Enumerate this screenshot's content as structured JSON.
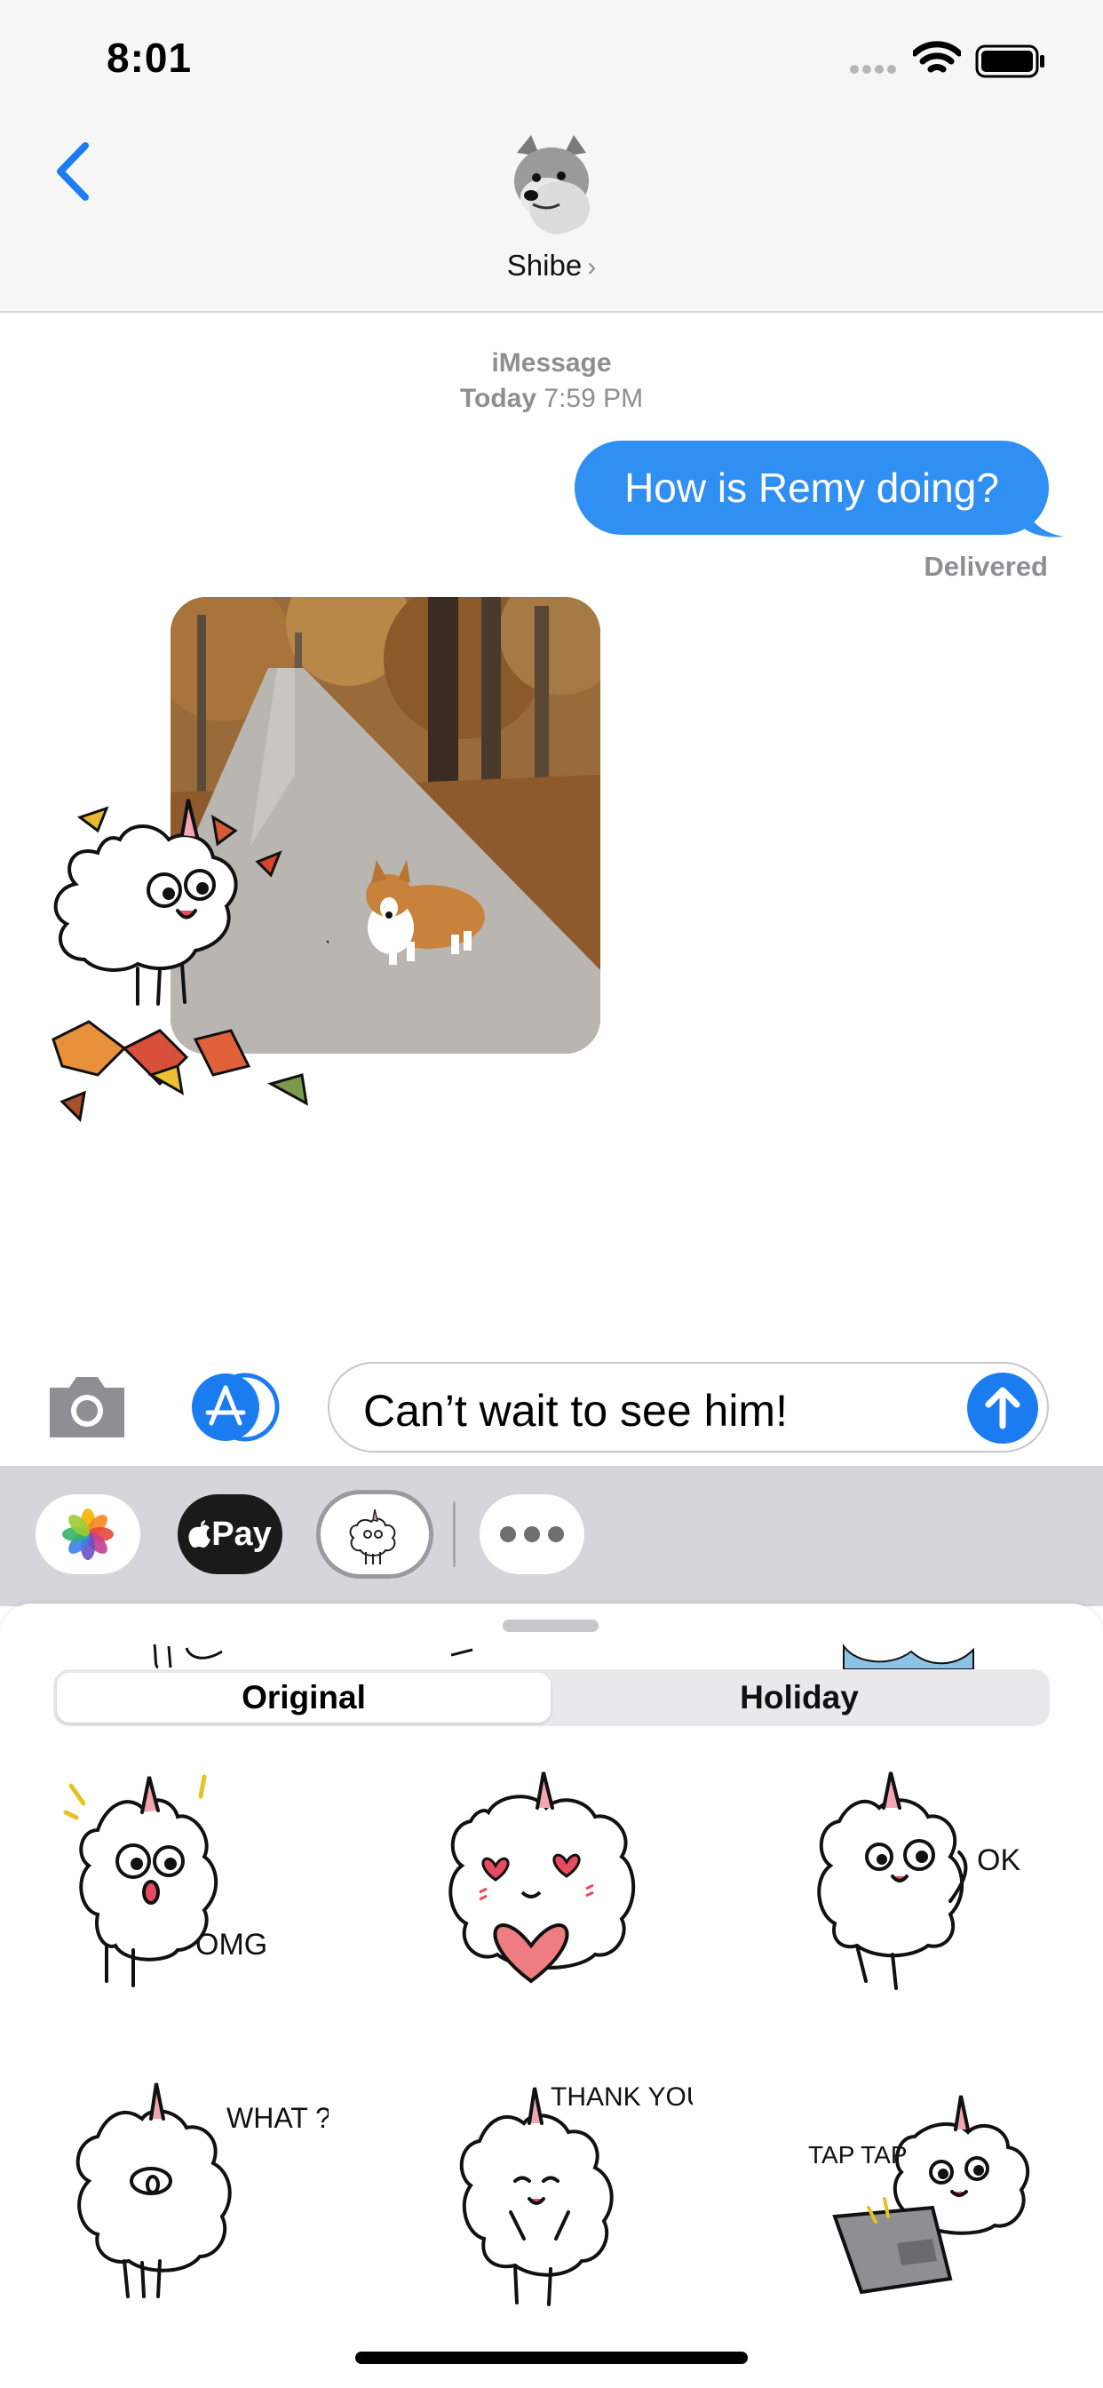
{
  "status_bar": {
    "time": "8:01"
  },
  "header": {
    "contact_name": "Shibe",
    "chevron": "›"
  },
  "conversation": {
    "service": "iMessage",
    "day": "Today",
    "time": "7:59 PM",
    "outgoing_message": "How is Remy doing?",
    "delivery_status": "Delivered"
  },
  "composer": {
    "text": "Can’t wait to see him!"
  },
  "apps": {
    "apple_pay_label": "Pay"
  },
  "sticker_panel": {
    "tabs": [
      {
        "label": "Original",
        "selected": true
      },
      {
        "label": "Holiday",
        "selected": false
      }
    ],
    "sticker_texts": [
      "OMG",
      "",
      "OK",
      "WHAT ?",
      "THANK YOU",
      "TAP TAP"
    ]
  },
  "colors": {
    "accent": "#2f8ff3",
    "send_button": "#1b7cf1",
    "drawer_bg": "#d5d6db",
    "secondary_text": "#8e8e93"
  }
}
